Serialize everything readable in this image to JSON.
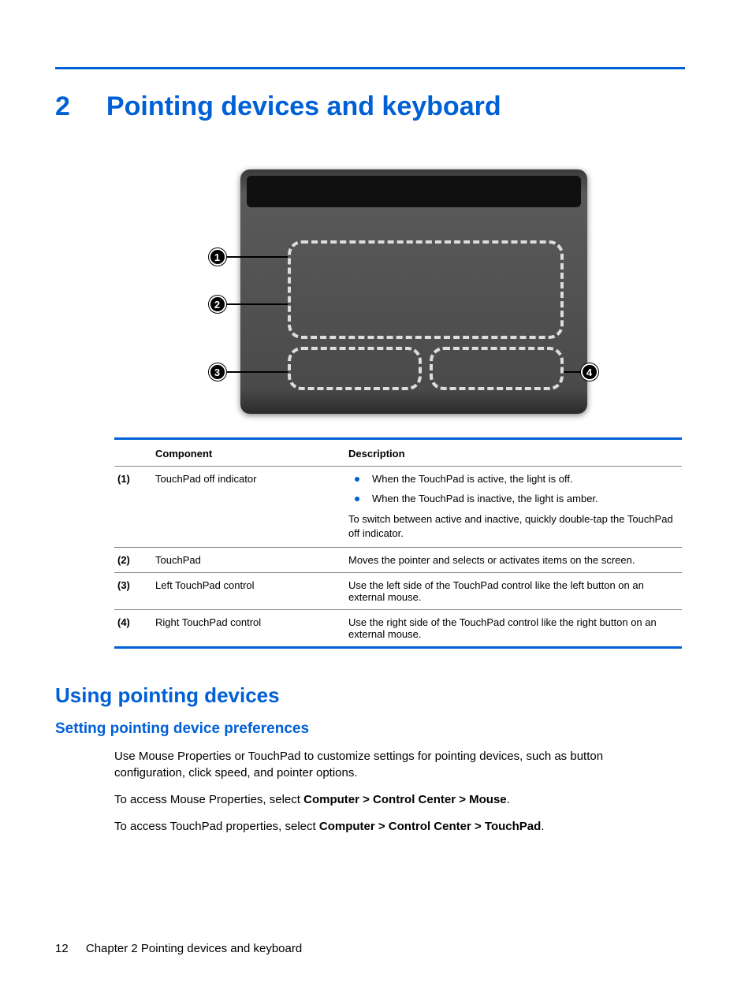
{
  "chapter": {
    "number": "2",
    "title": "Pointing devices and keyboard"
  },
  "callouts": {
    "c1": "1",
    "c2": "2",
    "c3": "3",
    "c4": "4"
  },
  "table": {
    "head_component": "Component",
    "head_description": "Description",
    "rows": [
      {
        "num": "(1)",
        "name": "TouchPad off indicator",
        "bullets": [
          "When the TouchPad is active, the light is off.",
          "When the TouchPad is inactive, the light is amber."
        ],
        "followup": "To switch between active and inactive, quickly double-tap the TouchPad off indicator."
      },
      {
        "num": "(2)",
        "name": "TouchPad",
        "text": "Moves the pointer and selects or activates items on the screen."
      },
      {
        "num": "(3)",
        "name": "Left TouchPad control",
        "text": "Use the left side of the TouchPad control like the left button on an external mouse."
      },
      {
        "num": "(4)",
        "name": "Right TouchPad control",
        "text": "Use the right side of the TouchPad control like the right button on an external mouse."
      }
    ]
  },
  "section": {
    "h2": "Using pointing devices",
    "h3": "Setting pointing device preferences",
    "p1": "Use Mouse Properties or TouchPad to customize settings for pointing devices, such as button configuration, click speed, and pointer options.",
    "p2_lead": "To access Mouse Properties, select ",
    "p2_bold": "Computer > Control Center > Mouse",
    "p2_tail": ".",
    "p3_lead": "To access TouchPad properties, select ",
    "p3_bold": "Computer > Control Center > TouchPad",
    "p3_tail": "."
  },
  "footer": {
    "page_number": "12",
    "chapter_label": "Chapter 2   Pointing devices and keyboard"
  }
}
